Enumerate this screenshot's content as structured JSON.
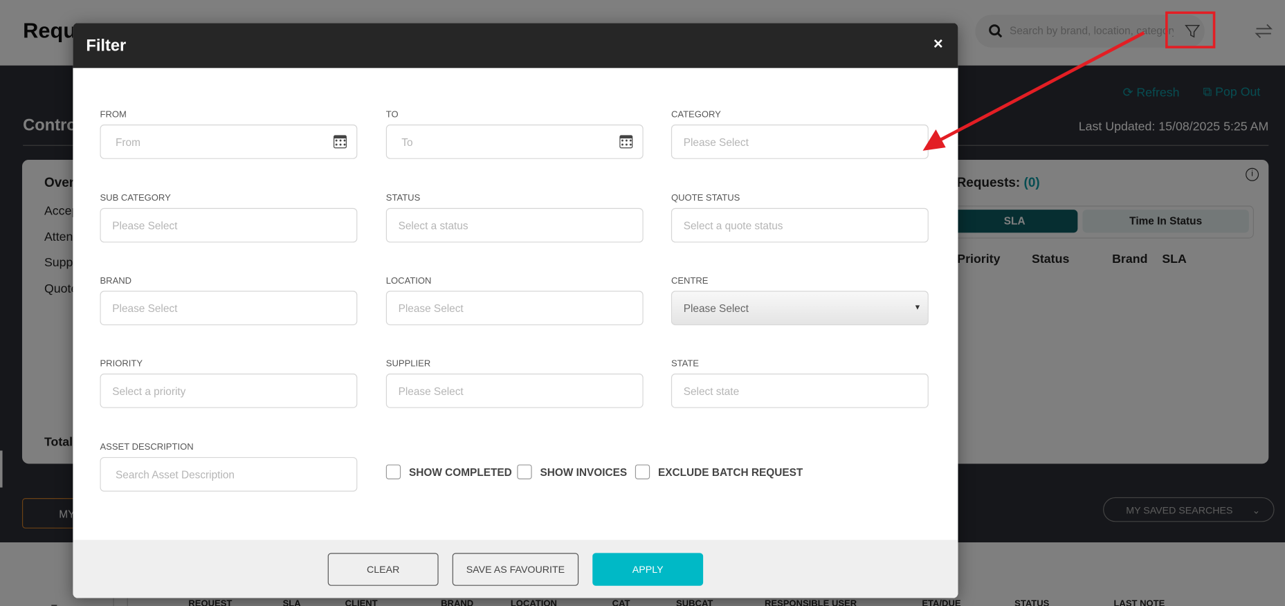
{
  "header": {
    "title": "Requests",
    "search_placeholder": "Search by brand, location, category or"
  },
  "toolbar": {
    "refresh": "Refresh",
    "pop_out": "Pop Out"
  },
  "control": {
    "title": "Control Centre",
    "last_updated": "Last Updated: 15/08/2025 5:25 AM"
  },
  "overview": {
    "title": "Overview",
    "items": [
      "Accepted",
      "Attendance",
      "Supplier",
      "Quotes"
    ],
    "total": "Total"
  },
  "priority": {
    "title": "Priority Requests:",
    "count": "(0)",
    "tabs": [
      "SLA",
      "Time In Status"
    ],
    "columns": [
      "Priority",
      "Status",
      "Brand",
      "SLA"
    ]
  },
  "my_button": "MY",
  "saved_searches": "MY SAVED SEARCHES",
  "table_headers": [
    "REQUEST",
    "SLA",
    "CLIENT",
    "BRAND",
    "LOCATION",
    "CAT",
    "SUBCAT",
    "RESPONSIBLE USER",
    "ETA/DUE",
    "STATUS",
    "LAST NOTE"
  ],
  "modal": {
    "title": "Filter",
    "close": "×",
    "fields": [
      {
        "label": "FROM",
        "placeholder": "From",
        "type": "date"
      },
      {
        "label": "TO",
        "placeholder": "To",
        "type": "date"
      },
      {
        "label": "CATEGORY",
        "placeholder": "Please Select",
        "type": "text"
      },
      {
        "label": "SUB CATEGORY",
        "placeholder": "Please Select",
        "type": "text"
      },
      {
        "label": "STATUS",
        "placeholder": "Select a status",
        "type": "text"
      },
      {
        "label": "QUOTE STATUS",
        "placeholder": "Select a quote status",
        "type": "text"
      },
      {
        "label": "BRAND",
        "placeholder": "Please Select",
        "type": "text"
      },
      {
        "label": "LOCATION",
        "placeholder": "Please Select",
        "type": "text"
      },
      {
        "label": "CENTRE",
        "placeholder": "Please Select",
        "type": "select"
      },
      {
        "label": "PRIORITY",
        "placeholder": "Select a priority",
        "type": "text"
      },
      {
        "label": "SUPPLIER",
        "placeholder": "Please Select",
        "type": "text"
      },
      {
        "label": "STATE",
        "placeholder": "Select state",
        "type": "text"
      },
      {
        "label": "ASSET DESCRIPTION",
        "placeholder": "Search Asset Description",
        "type": "text"
      }
    ],
    "checkboxes": [
      {
        "label": "SHOW COMPLETED",
        "checked": false
      },
      {
        "label": "SHOW INVOICES",
        "checked": false
      },
      {
        "label": "EXCLUDE BATCH REQUEST",
        "checked": false
      }
    ],
    "buttons": {
      "clear": "CLEAR",
      "save": "SAVE AS FAVOURITE",
      "apply": "APPLY"
    }
  },
  "colors": {
    "accent": "#00b9c6",
    "annotation": "#e31e24",
    "sla_tab": "#0d5c63"
  }
}
